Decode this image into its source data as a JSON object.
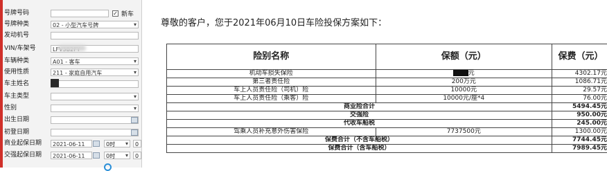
{
  "form": {
    "fields": [
      {
        "label": "号牌号码",
        "value": ""
      },
      {
        "label": "号牌种类",
        "value": "02 - 小型汽车号牌"
      },
      {
        "label": "发动机号",
        "value": ""
      },
      {
        "label": "VIN/车架号",
        "value": "LFV3B2FY"
      },
      {
        "label": "车辆种类",
        "value": "A01 - 客车"
      },
      {
        "label": "使用性质",
        "value": "211 - 家庭自用汽车"
      },
      {
        "label": "车主姓名",
        "value": ""
      },
      {
        "label": "车主类型",
        "value": ""
      },
      {
        "label": "性别",
        "value": ""
      },
      {
        "label": "出生日期",
        "value": ""
      },
      {
        "label": "初登日期",
        "value": ""
      },
      {
        "label": "商业起保日期",
        "value": "2021-06-11",
        "hour": "0时",
        "minute": "0"
      },
      {
        "label": "交强起保日期",
        "value": "2021-06-11",
        "hour": "0时",
        "minute": "0"
      }
    ],
    "new_car_label": "新车"
  },
  "document": {
    "greeting": "尊敬的客户，您于2021年06月10日车险投保方案如下：",
    "headers": {
      "name": "险别名称",
      "coverage": "保额（元）",
      "premium": "保费（元）"
    },
    "rows": [
      {
        "name": "机动车损失保险",
        "coverage": "元",
        "premium": "4302.17元"
      },
      {
        "name": "第三者责任险",
        "coverage": "200万元",
        "premium": "1086.71元"
      },
      {
        "name": "车上人员责任险（司机）险",
        "coverage": "10000元",
        "premium": "29.57元"
      },
      {
        "name": "车上人员责任险（乘客）险",
        "coverage": "10000元/座*4",
        "premium": "76.00元"
      }
    ],
    "commercial_total": {
      "label": "商业险合计",
      "value": "5494.45元"
    },
    "compulsory": {
      "label": "交强险",
      "value": "950.00元"
    },
    "vessel_tax": {
      "label": "代收车船税",
      "value": "245.00元"
    },
    "extra": {
      "name": "驾乘人员补充意外伤害保险",
      "coverage": "7737500元",
      "premium": "1300.00元"
    },
    "total_ex_tax": {
      "label": "保费合计（不含车船税）",
      "value": "7744.45元"
    },
    "total_inc_tax": {
      "label": "保费合计（含车船税）",
      "value": "7989.45元"
    }
  }
}
